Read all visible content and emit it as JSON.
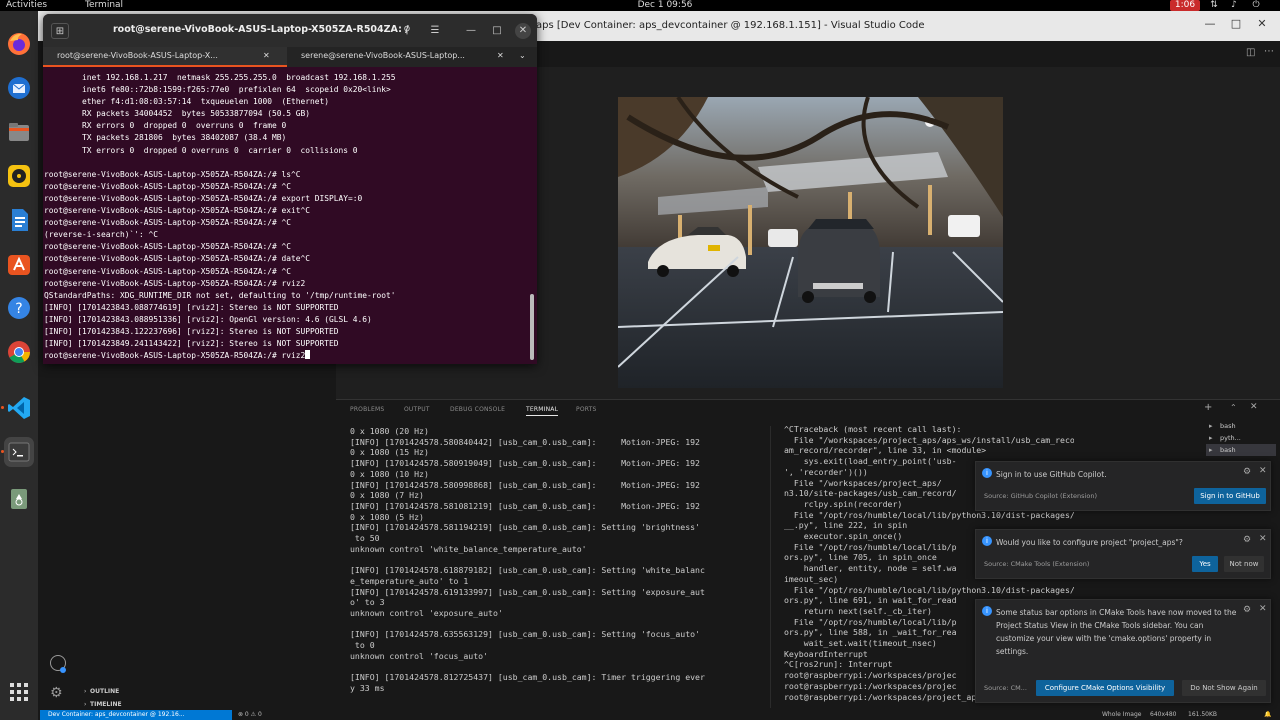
{
  "topbar": {
    "activities": "Activities",
    "app_name": "Terminal",
    "clock": "Dec 1 09:56",
    "recording": "1:06"
  },
  "terminal": {
    "title": "root@serene-VivoBook-ASUS-Laptop-X505ZA-R504ZA: /",
    "tabs": [
      {
        "label": "root@serene-VivoBook-ASUS-Laptop-X..."
      },
      {
        "label": "serene@serene-VivoBook-ASUS-Laptop..."
      }
    ],
    "output": "        inet 192.168.1.217  netmask 255.255.255.0  broadcast 192.168.1.255\n        inet6 fe80::72b8:1599:f265:77e0  prefixlen 64  scopeid 0x20<link>\n        ether f4:d1:08:03:57:14  txqueuelen 1000  (Ethernet)\n        RX packets 34004452  bytes 50533877094 (50.5 GB)\n        RX errors 0  dropped 0  overruns 0  frame 0\n        TX packets 281806  bytes 38402087 (38.4 MB)\n        TX errors 0  dropped 0 overruns 0  carrier 0  collisions 0\n\nroot@serene-VivoBook-ASUS-Laptop-X505ZA-R504ZA:/# ls^C\nroot@serene-VivoBook-ASUS-Laptop-X505ZA-R504ZA:/# ^C\nroot@serene-VivoBook-ASUS-Laptop-X505ZA-R504ZA:/# export DISPLAY=:0\nroot@serene-VivoBook-ASUS-Laptop-X505ZA-R504ZA:/# exit^C\nroot@serene-VivoBook-ASUS-Laptop-X505ZA-R504ZA:/# ^C\n(reverse-i-search)`': ^C\nroot@serene-VivoBook-ASUS-Laptop-X505ZA-R504ZA:/# ^C\nroot@serene-VivoBook-ASUS-Laptop-X505ZA-R504ZA:/# date^C\nroot@serene-VivoBook-ASUS-Laptop-X505ZA-R504ZA:/# ^C\nroot@serene-VivoBook-ASUS-Laptop-X505ZA-R504ZA:/# rviz2\nQStandardPaths: XDG_RUNTIME_DIR not set, defaulting to '/tmp/runtime-root'\n[INFO] [1701423843.088774619] [rviz2]: Stereo is NOT SUPPORTED\n[INFO] [1701423843.088951336] [rviz2]: OpenGl version: 4.6 (GLSL 4.6)\n[INFO] [1701423843.122237696] [rviz2]: Stereo is NOT SUPPORTED\n[INFO] [1701423849.241143422] [rviz2]: Stereo is NOT SUPPORTED\nroot@serene-VivoBook-ASUS-Laptop-X505ZA-R504ZA:/# rviz2"
  },
  "vscode": {
    "title": "aps [Dev Container: aps_devcontainer @ 192.168.1.151] - Visual Studio Code",
    "panel_tabs": [
      "PROBLEMS",
      "OUTPUT",
      "DEBUG CONSOLE",
      "TERMINAL",
      "PORTS"
    ],
    "terminal_left": "0 x 1080 (20 Hz)\n[INFO] [1701424578.580840442] [usb_cam_0.usb_cam]:     Motion-JPEG: 192\n0 x 1080 (15 Hz)\n[INFO] [1701424578.580919049] [usb_cam_0.usb_cam]:     Motion-JPEG: 192\n0 x 1080 (10 Hz)\n[INFO] [1701424578.580998868] [usb_cam_0.usb_cam]:     Motion-JPEG: 192\n0 x 1080 (7 Hz)\n[INFO] [1701424578.581081219] [usb_cam_0.usb_cam]:     Motion-JPEG: 192\n0 x 1080 (5 Hz)\n[INFO] [1701424578.581194219] [usb_cam_0.usb_cam]: Setting 'brightness'\n to 50\nunknown control 'white_balance_temperature_auto'\n\n[INFO] [1701424578.618879182] [usb_cam_0.usb_cam]: Setting 'white_balanc\ne_temperature_auto' to 1\n[INFO] [1701424578.619133997] [usb_cam_0.usb_cam]: Setting 'exposure_aut\no' to 3\nunknown control 'exposure_auto'\n\n[INFO] [1701424578.635563129] [usb_cam_0.usb_cam]: Setting 'focus_auto'\n to 0\nunknown control 'focus_auto'\n\n[INFO] [1701424578.812725437] [usb_cam_0.usb_cam]: Timer triggering ever\ny 33 ms",
    "terminal_right": "^CTraceback (most recent call last):\n  File \"/workspaces/project_aps/aps_ws/install/usb_cam_record/lib/usb_c\nam_record/recorder\", line 33, in <module>\n    sys.exit(load_entry_point('usb-\n', 'recorder')())\n  File \"/workspaces/project_aps/\nn3.10/site-packages/usb_cam_record/\n    rclpy.spin(recorder)\n  File \"/opt/ros/humble/local/lib/python3.10/dist-packages/rclpy/__init\n__.py\", line 222, in spin\n    executor.spin_once()\n  File \"/opt/ros/humble/local/lib/p\nors.py\", line 705, in spin_once\n    handler, entity, node = self.wa\nimeout_sec)\n  File \"/opt/ros/humble/local/lib/python3.10/dist-packages/rclpy/execut\nors.py\", line 691, in wait_for_read\n    return next(self._cb_iter)\n  File \"/opt/ros/humble/local/lib/p\nors.py\", line 588, in _wait_for_rea\n    wait_set.wait(timeout_nsec)\nKeyboardInterrupt\n^C[ros2run]: Interrupt\nroot@raspberrypi:/workspaces/projec\nroot@raspberrypi:/workspaces/projec\nroot@raspberrypi:/workspaces/project_aps/aps_ws#",
    "bash_tabs": [
      "bash",
      "pyth...",
      "bash"
    ],
    "sidebar_sections": {
      "outline": "OUTLINE",
      "timeline": "TIMELINE"
    },
    "status": {
      "remote": "Dev Container: aps_devcontainer @ 192.16...",
      "right": [
        "Whole Image",
        "640x480",
        "161.50KB"
      ]
    },
    "notifications": [
      {
        "message": "Sign in to use GitHub Copilot.",
        "source": "Source: GitHub Copilot (Extension)",
        "buttons": [
          "Sign in to GitHub"
        ]
      },
      {
        "message": "Would you like to configure project \"project_aps\"?",
        "source": "Source: CMake Tools (Extension)",
        "buttons": [
          "Yes",
          "Not now"
        ]
      },
      {
        "message": "Some status bar options in CMake Tools have now moved to the Project Status View in the CMake Tools sidebar. You can customize your view with the 'cmake.options' property in settings.",
        "source": "Source: CM...",
        "buttons": [
          "Configure CMake Options Visibility",
          "Do Not Show Again"
        ]
      }
    ]
  },
  "dock": {
    "items": [
      "firefox-icon",
      "thunderbird-icon",
      "files-icon",
      "rhythmbox-icon",
      "writer-icon",
      "app-center-icon",
      "help-icon",
      "chrome-icon",
      "vscode-icon",
      "terminal-icon",
      "trash-icon",
      "app-grid-icon"
    ]
  },
  "colors": {
    "terminal_bg": "#300a24",
    "vscode_bg": "#1e1e1e",
    "accent": "#0078d4",
    "button": "#0e639c"
  }
}
